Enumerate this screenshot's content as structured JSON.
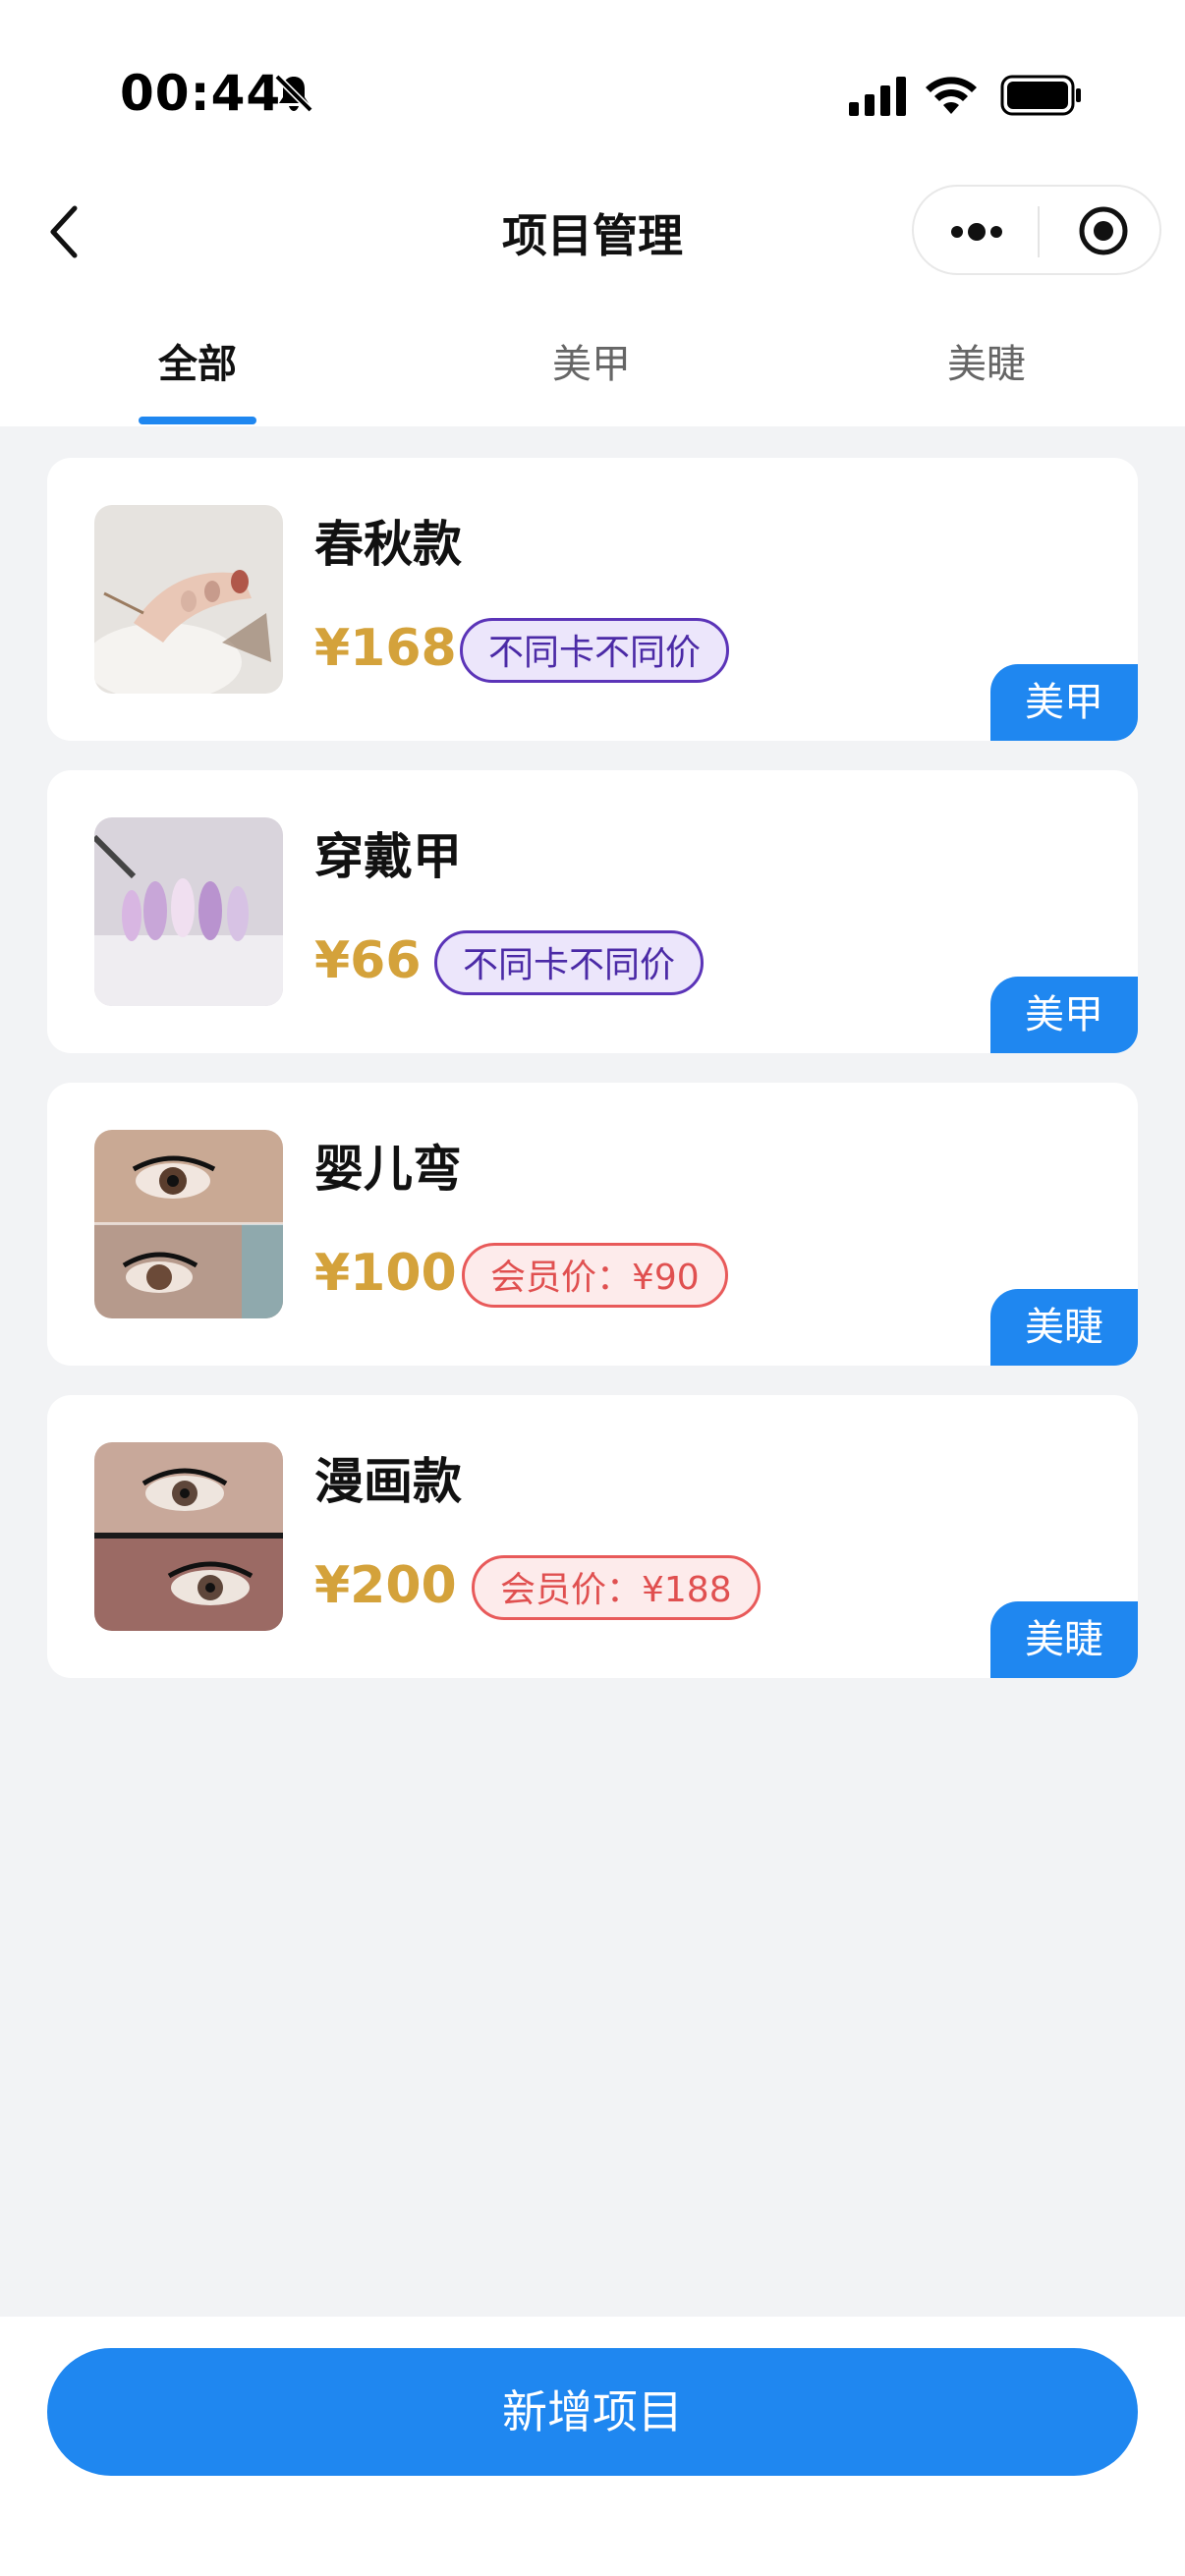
{
  "status_bar": {
    "time": "00:44"
  },
  "nav": {
    "title": "项目管理"
  },
  "tabs": [
    {
      "label": "全部",
      "active": true
    },
    {
      "label": "美甲",
      "active": false
    },
    {
      "label": "美睫",
      "active": false
    }
  ],
  "items": [
    {
      "name": "春秋款",
      "price": "¥168",
      "price_tag": "不同卡不同价",
      "tag_style": "purple",
      "category": "美甲",
      "image": "nail-photo"
    },
    {
      "name": "穿戴甲",
      "price": "¥66",
      "price_tag": "不同卡不同价",
      "tag_style": "purple",
      "category": "美甲",
      "image": "press-on-nails-photo"
    },
    {
      "name": "婴儿弯",
      "price": "¥100",
      "price_tag": "会员价：¥90",
      "tag_style": "red",
      "category": "美睫",
      "image": "eyelash-photo"
    },
    {
      "name": "漫画款",
      "price": "¥200",
      "price_tag": "会员价：¥188",
      "tag_style": "red",
      "category": "美睫",
      "image": "eyelash-photo"
    }
  ],
  "footer": {
    "add_label": "新增项目"
  },
  "colors": {
    "accent": "#1f87f0",
    "price": "#d4a23b",
    "tag_purple": "#5b34b8",
    "tag_red": "#e85a5a",
    "background": "#f2f3f5"
  }
}
